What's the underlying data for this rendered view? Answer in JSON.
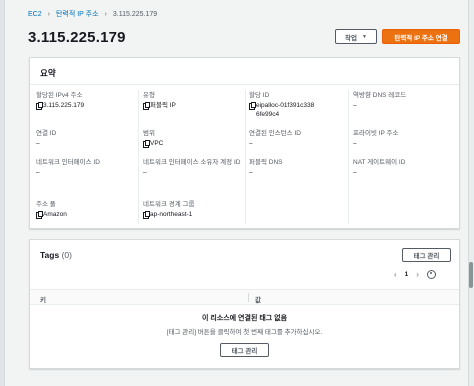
{
  "breadcrumb": {
    "root": "EC2",
    "section": "탄력적 IP 주소",
    "current": "3.115.225.179"
  },
  "page_title": "3.115.225.179",
  "actions_button": "작업",
  "primary_button": "탄력적 IP 주소 연결",
  "summary": {
    "heading": "요약",
    "fields": [
      {
        "label": "할당된 IPv4 주소",
        "value": "3.115.225.179",
        "copy": true
      },
      {
        "label": "유형",
        "value": "퍼블릭 IP",
        "copy": true
      },
      {
        "label": "할당 ID",
        "value": "eipalloc-01f391c3386fe99c4",
        "copy": true
      },
      {
        "label": "역방향 DNS 레코드",
        "value": "–",
        "copy": false
      },
      {
        "label": "연결 ID",
        "value": "–",
        "copy": false
      },
      {
        "label": "범위",
        "value": "VPC",
        "copy": true
      },
      {
        "label": "연결된 인스턴스 ID",
        "value": "–",
        "copy": false
      },
      {
        "label": "프라이빗 IP 주소",
        "value": "–",
        "copy": false
      },
      {
        "label": "네트워크 인터페이스 ID",
        "value": "–",
        "copy": false
      },
      {
        "label": "네트워크 인터페이스 소유자 계정 ID",
        "value": "–",
        "copy": false
      },
      {
        "label": "퍼블릭 DNS",
        "value": "–",
        "copy": false
      },
      {
        "label": "NAT 게이트웨이 ID",
        "value": "–",
        "copy": false
      },
      {
        "label": "주소 풀",
        "value": "Amazon",
        "copy": true
      },
      {
        "label": "네트워크 경계 그룹",
        "value": "ap-northeast-1",
        "copy": true
      }
    ]
  },
  "tags": {
    "title": "Tags",
    "count": "(0)",
    "manage_button": "태그 관리",
    "page": "1",
    "columns": [
      "키",
      "값"
    ],
    "empty_title": "이 리소스에 연결된 태그 없음",
    "empty_desc": "[태그 관리] 버튼을 클릭하여 첫 번째 태그를 추가하십시오.",
    "empty_button": "태그 관리"
  }
}
